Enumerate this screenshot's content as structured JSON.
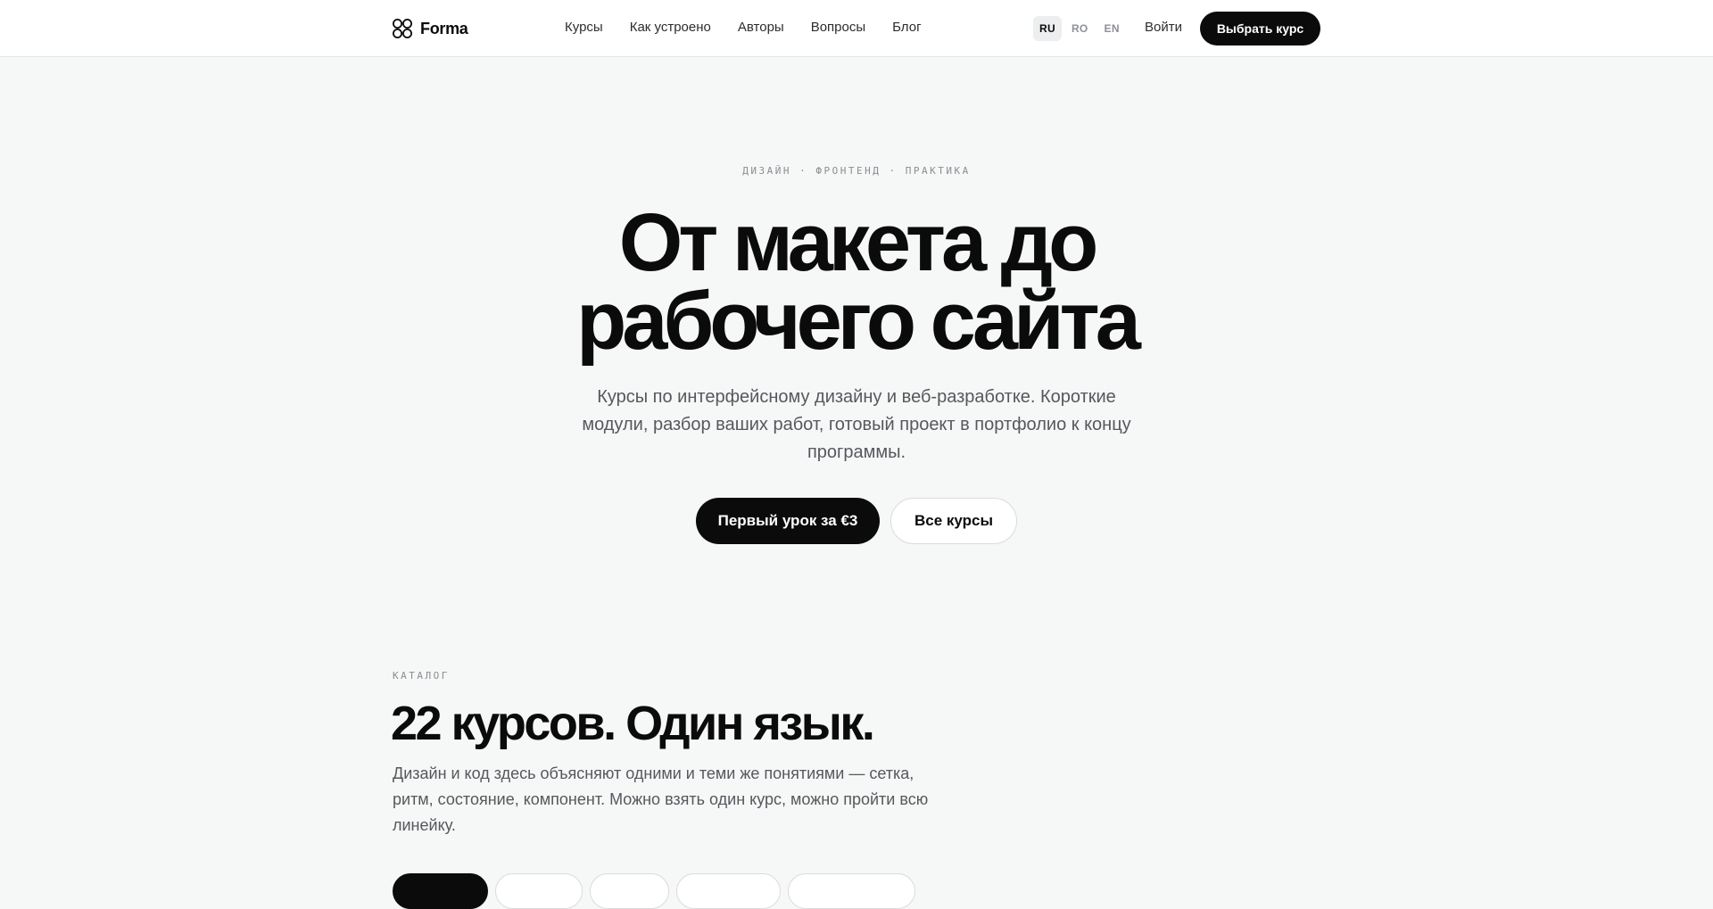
{
  "header": {
    "brand_name": "Forma",
    "logo_icon": "four-circles-logo-icon",
    "nav": [
      {
        "label": "Курсы"
      },
      {
        "label": "Как устроено"
      },
      {
        "label": "Авторы"
      },
      {
        "label": "Вопросы"
      },
      {
        "label": "Блог"
      }
    ],
    "languages": [
      {
        "code": "RU",
        "active": true
      },
      {
        "code": "RO",
        "active": false
      },
      {
        "code": "EN",
        "active": false
      }
    ],
    "login_label": "Войти",
    "cta_label": "Выбрать курс"
  },
  "hero": {
    "eyebrow": "ДИЗАЙН · ФРОНТЕНД · ПРАКТИКА",
    "title_line1": "От макета до",
    "title_line2": "рабочего сайта",
    "subtitle": "Курсы по интерфейсному дизайну и веб-разработке. Короткие модули, разбор ваших работ, готовый проект в портфолио к концу программы.",
    "primary_cta": "Первый урок за €3",
    "secondary_cta": "Все курсы"
  },
  "catalog": {
    "eyebrow": "КАТАЛОГ",
    "title": "22 курсов. Один язык.",
    "description": "Дизайн и код здесь объясняют одними и теми же понятиями — сетка, ритм, состояние, компонент. Можно взять один курс, можно пройти всю линейку."
  },
  "colors": {
    "accent": "#0b0b0c",
    "page_background": "#f6f7f7",
    "header_background": "#ffffff",
    "muted_text": "#55585d"
  }
}
